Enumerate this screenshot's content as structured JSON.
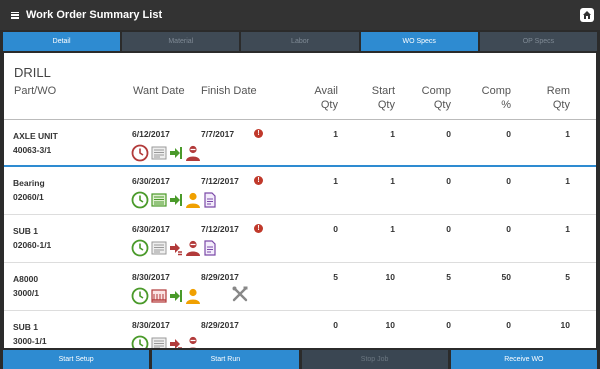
{
  "header": {
    "title": "Work Order Summary List"
  },
  "tabs": [
    {
      "label": "Detail",
      "active": true
    },
    {
      "label": "Material",
      "active": false
    },
    {
      "label": "Labor",
      "active": false
    },
    {
      "label": "WO Specs",
      "active": true
    },
    {
      "label": "OP Specs",
      "active": false
    }
  ],
  "section": {
    "title": "DRILL"
  },
  "columns": {
    "part": "Part/WO",
    "want": "Want Date",
    "finish": "Finish Date",
    "avail": [
      "Avail",
      "Qty"
    ],
    "start": [
      "Start",
      "Qty"
    ],
    "comp": [
      "Comp",
      "Qty"
    ],
    "comppct": [
      "Comp",
      "%"
    ],
    "rem": [
      "Rem",
      "Qty"
    ]
  },
  "rows": [
    {
      "part": "AXLE UNIT",
      "wo": "40063-3/1",
      "want": "6/12/2017",
      "finish": "7/7/2017",
      "warn": true,
      "avail": "1",
      "start": "1",
      "comp": "0",
      "comppct": "0",
      "rem": "1",
      "icons": [
        "clock-red-icon",
        "doc-gray-icon",
        "arrow-green-icon",
        "person-red-icon"
      ]
    },
    {
      "part": "Bearing",
      "wo": "02060/1",
      "want": "6/30/2017",
      "finish": "7/12/2017",
      "warn": true,
      "avail": "1",
      "start": "1",
      "comp": "0",
      "comppct": "0",
      "rem": "1",
      "icons": [
        "clock-green-icon",
        "list-green-icon",
        "arrow-green-icon",
        "person-orange-icon",
        "page-purple-icon"
      ]
    },
    {
      "part": "SUB 1",
      "wo": "02060-1/1",
      "want": "6/30/2017",
      "finish": "7/12/2017",
      "warn": true,
      "avail": "0",
      "start": "1",
      "comp": "0",
      "comppct": "0",
      "rem": "1",
      "icons": [
        "clock-green-icon",
        "doc-gray-icon",
        "arrow-red-icon",
        "person-red-icon",
        "page-purple-icon"
      ]
    },
    {
      "part": "A8000",
      "wo": "3000/1",
      "want": "8/30/2017",
      "finish": "8/29/2017",
      "warn": false,
      "avail": "5",
      "start": "10",
      "comp": "5",
      "comppct": "50",
      "rem": "5",
      "icons": [
        "clock-green-icon",
        "box-red-icon",
        "arrow-green-icon",
        "person-orange-icon"
      ],
      "tools": true
    },
    {
      "part": "SUB 1",
      "wo": "3000-1/1",
      "want": "8/30/2017",
      "finish": "8/29/2017",
      "warn": false,
      "avail": "0",
      "start": "10",
      "comp": "0",
      "comppct": "0",
      "rem": "10",
      "icons": [
        "clock-green-icon",
        "doc-gray-icon",
        "arrow-red-icon",
        "person-red-icon"
      ]
    }
  ],
  "buttons": [
    {
      "label": "Start Setup",
      "enabled": true
    },
    {
      "label": "Start Run",
      "enabled": true
    },
    {
      "label": "Stop Job",
      "enabled": false
    },
    {
      "label": "Receive WO",
      "enabled": true
    }
  ],
  "colors": {
    "accent": "#2e8bd1",
    "green": "#4a9a2a",
    "red": "#b23a3a",
    "orange": "#f0a000",
    "purple": "#7b4aa8"
  }
}
